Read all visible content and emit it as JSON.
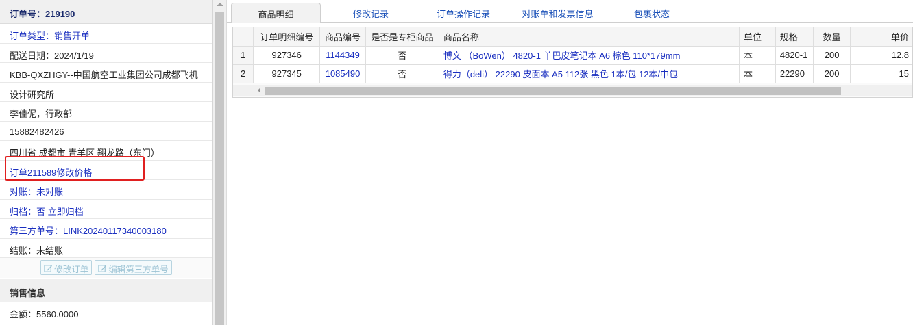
{
  "order": {
    "header": "订单号：219190",
    "rows": [
      {
        "text": "订单类型：销售开单",
        "blue": true
      },
      {
        "text": "配送日期：2024/1/19",
        "blue": false
      },
      {
        "text": "KBB-QXZHGY--中国航空工业集团公司成都飞机",
        "blue": false
      },
      {
        "text": "设计研究所",
        "blue": false
      },
      {
        "text": "李佳伲，行政部",
        "blue": false
      },
      {
        "text": "15882482426",
        "blue": false
      },
      {
        "text": "四川省 成都市 青羊区 翔龙路（东门）",
        "blue": false
      },
      {
        "text": "订单211589修改价格",
        "blue": true
      },
      {
        "text": "对账：未对账",
        "blue": true
      },
      {
        "text": "归档：否 立即归档",
        "blue": true
      },
      {
        "text": "第三方单号：LINK20240117340003180",
        "blue": true
      },
      {
        "text": "结账：未结账",
        "blue": false
      }
    ],
    "buttons": {
      "edit_order": "修改订单",
      "edit_third_party": "编辑第三方单号"
    }
  },
  "sales": {
    "header": "销售信息",
    "amount": "金额：5560.0000"
  },
  "tabs": [
    {
      "label": "商品明细",
      "active": true
    },
    {
      "label": "修改记录",
      "active": false
    },
    {
      "label": "订单操作记录",
      "active": false
    },
    {
      "label": "对账单和发票信息",
      "active": false
    },
    {
      "label": "包裹状态",
      "active": false
    }
  ],
  "grid": {
    "columns": [
      "",
      "订单明细编号",
      "商品编号",
      "是否是专柜商品",
      "商品名称",
      "单位",
      "规格",
      "数量",
      "单价"
    ],
    "rows": [
      [
        "1",
        "927346",
        "1144349",
        "否",
        "博文 （BoWen） 4820-1 羊巴皮笔记本 A6 棕色 110*179mm",
        "本",
        "4820-1",
        "200",
        "12.8"
      ],
      [
        "2",
        "927345",
        "1085490",
        "否",
        "得力（deli） 22290 皮面本 A5 112张 黑色 1本/包 12本/中包",
        "本",
        "22290",
        "200",
        "15"
      ]
    ]
  },
  "icons": {
    "edit": "edit-icon"
  }
}
